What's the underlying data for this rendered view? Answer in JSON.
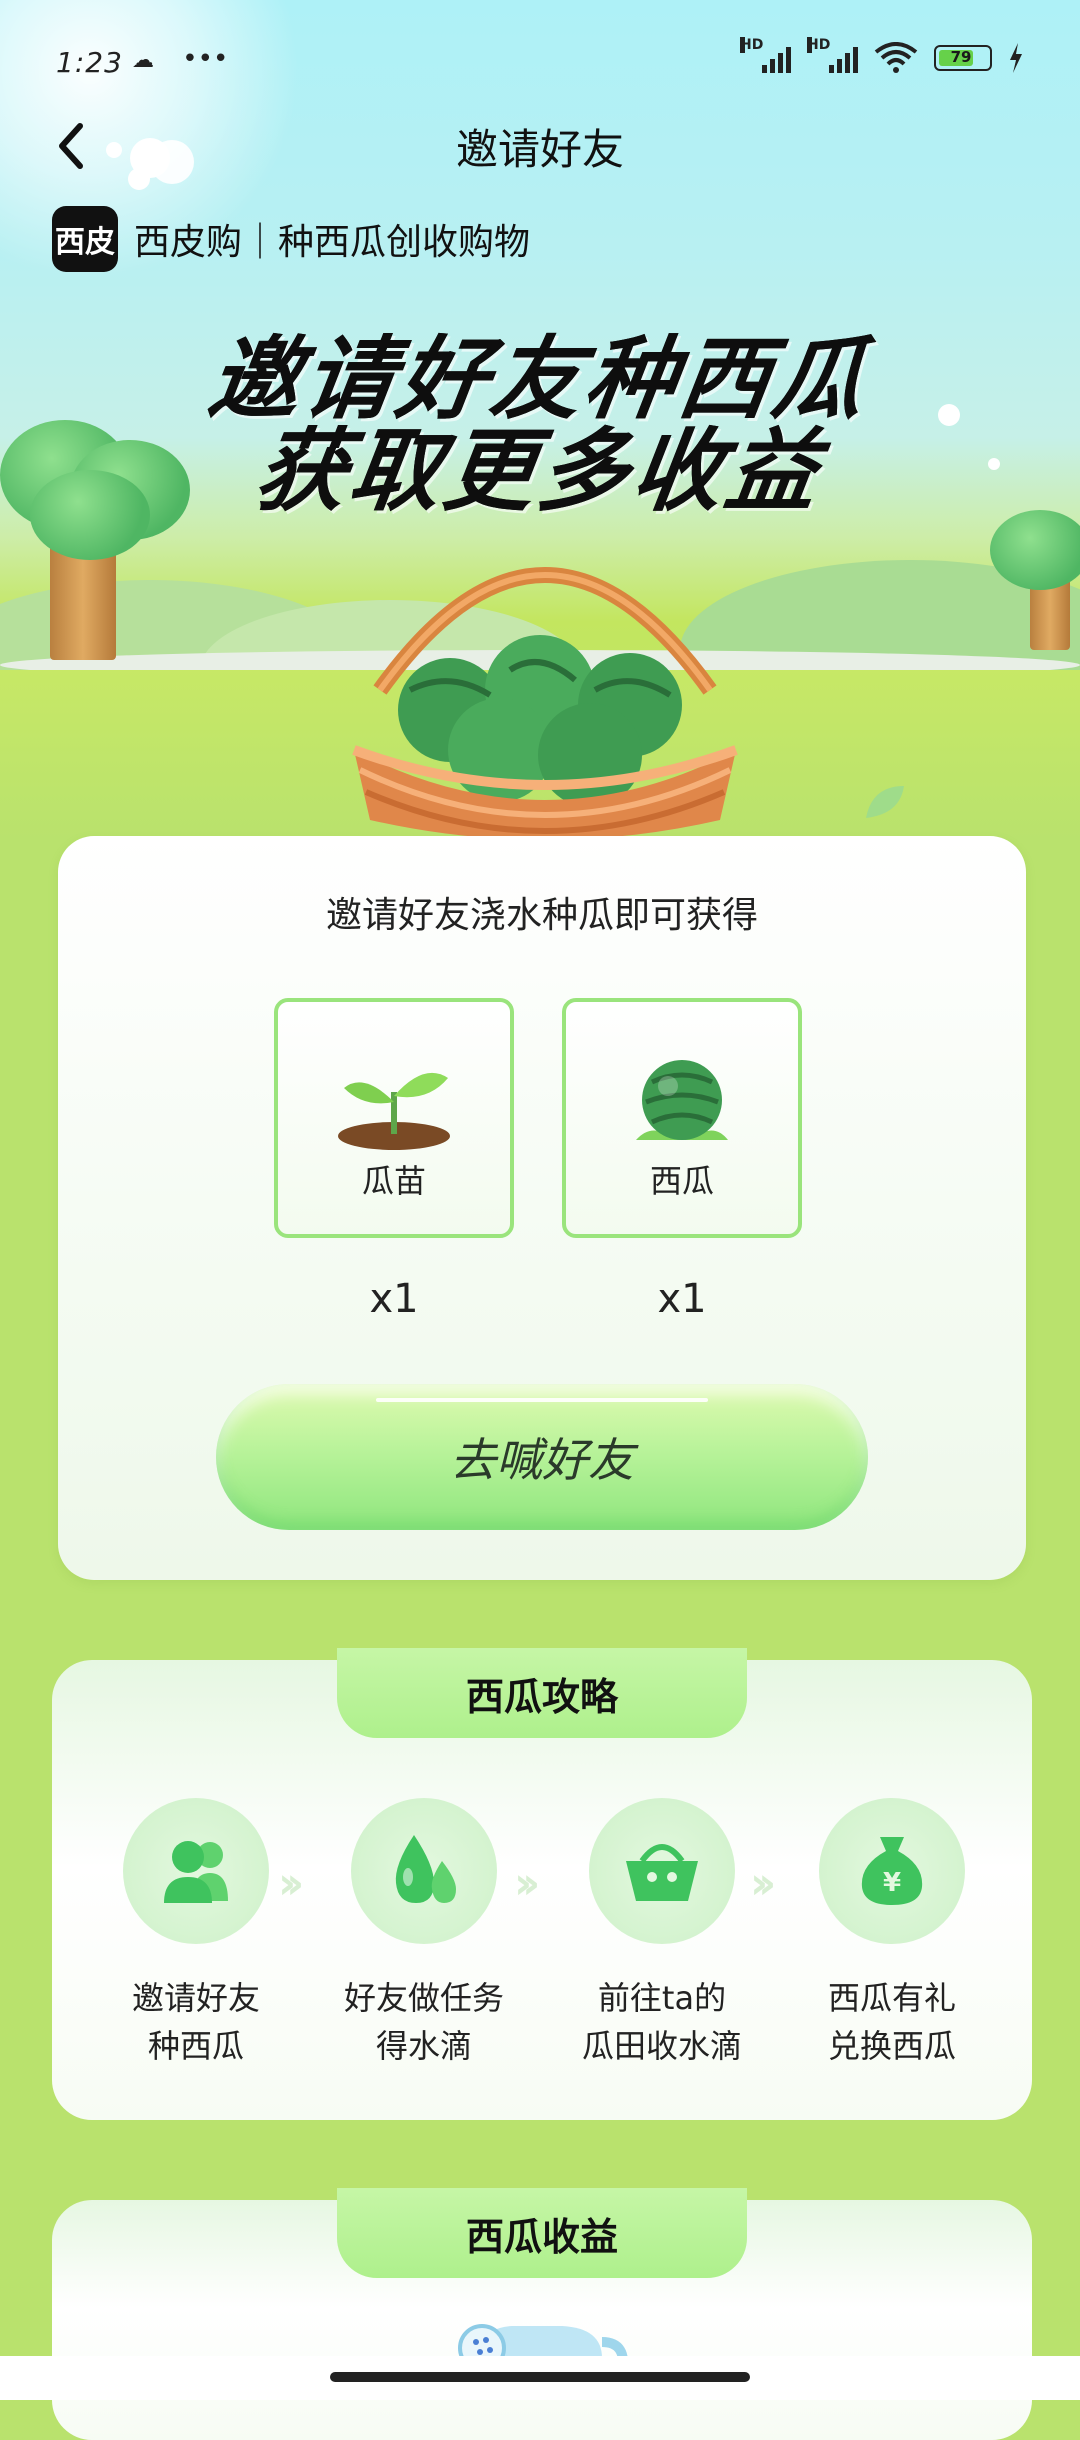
{
  "status": {
    "time": "1:23",
    "battery": "79",
    "signal1": "HD",
    "signal2": "HD",
    "more": "•••"
  },
  "nav": {
    "title": "邀请好友"
  },
  "brand": {
    "logo": "西皮",
    "text": "西皮购｜种西瓜创收购物"
  },
  "headline": {
    "line1": "邀请好友种西瓜",
    "line2": "获取更多收益"
  },
  "card": {
    "title": "邀请好友浇水种瓜即可获得",
    "rewards": [
      {
        "label": "瓜苗",
        "qty": "x1",
        "icon": "seedling-icon"
      },
      {
        "label": "西瓜",
        "qty": "x1",
        "icon": "watermelon-icon"
      }
    ],
    "cta": "去喊好友"
  },
  "guide": {
    "title": "西瓜攻略",
    "steps": [
      {
        "line1": "邀请好友",
        "line2": "种西瓜",
        "icon": "friends-icon"
      },
      {
        "line1": "好友做任务",
        "line2": "得水滴",
        "icon": "water-drops-icon"
      },
      {
        "line1": "前往ta的",
        "line2": "瓜田收水滴",
        "icon": "basket-icon"
      },
      {
        "line1": "西瓜有礼",
        "line2": "兑换西瓜",
        "icon": "money-bag-icon"
      }
    ]
  },
  "earnings": {
    "title": "西瓜收益"
  },
  "colors": {
    "accent": "#8fe67e",
    "background": "#b9e26d"
  }
}
